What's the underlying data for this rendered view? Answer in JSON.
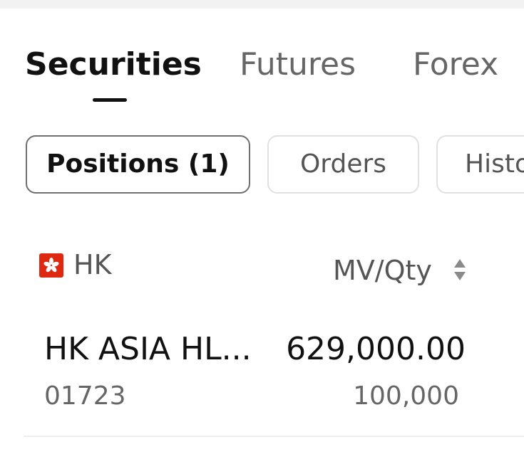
{
  "tabs": [
    {
      "label": "Securities",
      "active": true
    },
    {
      "label": "Futures",
      "active": false
    },
    {
      "label": "Forex",
      "active": false
    }
  ],
  "subtabs": [
    {
      "label": "Positions (1)",
      "active": true
    },
    {
      "label": "Orders",
      "active": false
    },
    {
      "label": "Histo",
      "active": false
    }
  ],
  "market": {
    "label": "HK",
    "flag_icon": "hong-kong-flag-icon",
    "column_header": "MV/Qty",
    "sort_icon": "sort-updown-icon"
  },
  "positions": [
    {
      "name": "HK ASIA HL...",
      "code": "01723",
      "market_value": "629,000.00",
      "quantity": "100,000"
    }
  ],
  "colors": {
    "active_text": "#111111",
    "inactive_text": "#666666",
    "active_border": "#6f6f6f",
    "inactive_border": "#e1e1e1",
    "flag_red": "#de2910"
  }
}
